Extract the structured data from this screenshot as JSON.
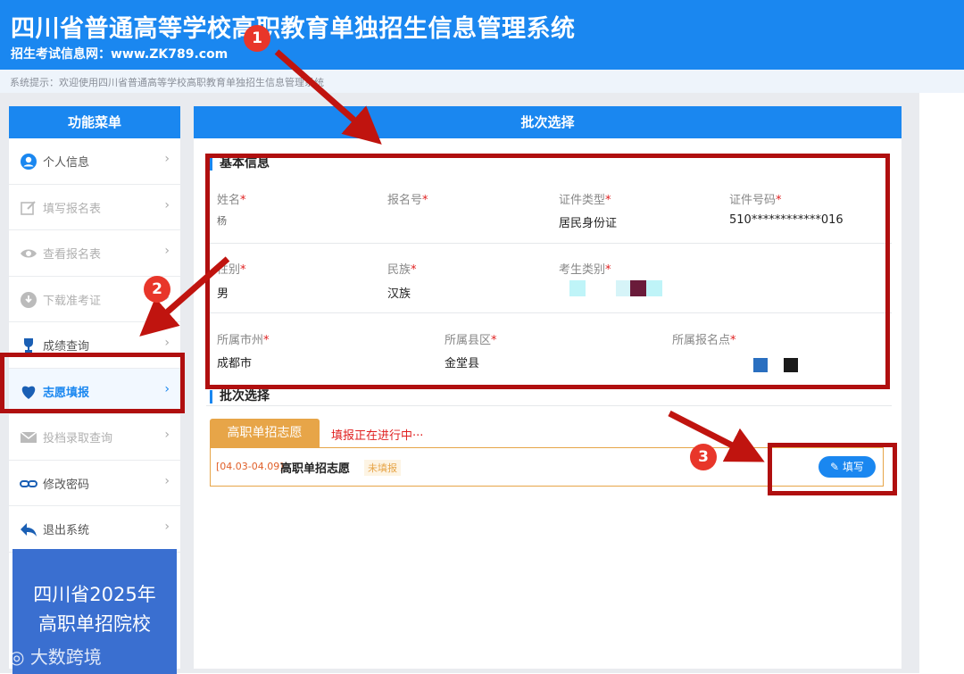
{
  "header": {
    "title": "四川省普通高等学校高职教育单独招生信息管理系统",
    "subtitle": "招生考试信息网：www.ZK789.com"
  },
  "notice": "系统提示：欢迎使用四川省普通高等学校高职教育单独招生信息管理系统",
  "sidebar": {
    "title": "功能菜单",
    "items": [
      {
        "label": "个人信息",
        "icon": "user-circle-icon"
      },
      {
        "label": "填写报名表",
        "icon": "edit-icon"
      },
      {
        "label": "查看报名表",
        "icon": "eye-icon"
      },
      {
        "label": "下载准考证",
        "icon": "cloud-download-icon"
      },
      {
        "label": "成绩查询",
        "icon": "trophy-icon"
      },
      {
        "label": "志愿填报",
        "icon": "heart-icon"
      },
      {
        "label": "投档录取查询",
        "icon": "mail-icon"
      },
      {
        "label": "修改密码",
        "icon": "link-icon"
      },
      {
        "label": "退出系统",
        "icon": "back-arrow-icon"
      }
    ],
    "banner": {
      "line1": "四川省2025年",
      "line2": "高职单招院校"
    }
  },
  "main": {
    "title": "批次选择",
    "basic_info": {
      "section_title": "基本信息",
      "name_label": "姓名",
      "name_value": "杨",
      "regno_label": "报名号",
      "idtype_label": "证件类型",
      "idtype_value": "居民身份证",
      "idno_label": "证件号码",
      "idno_value": "510************016",
      "gender_label": "性别",
      "gender_value": "男",
      "ethnic_label": "民族",
      "ethnic_value": "汉族",
      "category_label": "考生类别",
      "city_label": "所属市州",
      "city_value": "成都市",
      "county_label": "所属县区",
      "county_value": "金堂县",
      "site_label": "所属报名点"
    },
    "batch": {
      "section_title": "批次选择",
      "tab_label": "高职单招志愿",
      "status": "填报正在进行中···",
      "date_range": "[04.03-04.09]",
      "name": "高职单招志愿",
      "tag": "未填报",
      "button_label": "填写"
    }
  },
  "annotations": {
    "n1": "1",
    "n2": "2",
    "n3": "3"
  },
  "watermark": "大数跨境",
  "colors": {
    "primary": "#1a87f0",
    "annotation": "#b00f0f",
    "batch": "#e7a548"
  }
}
